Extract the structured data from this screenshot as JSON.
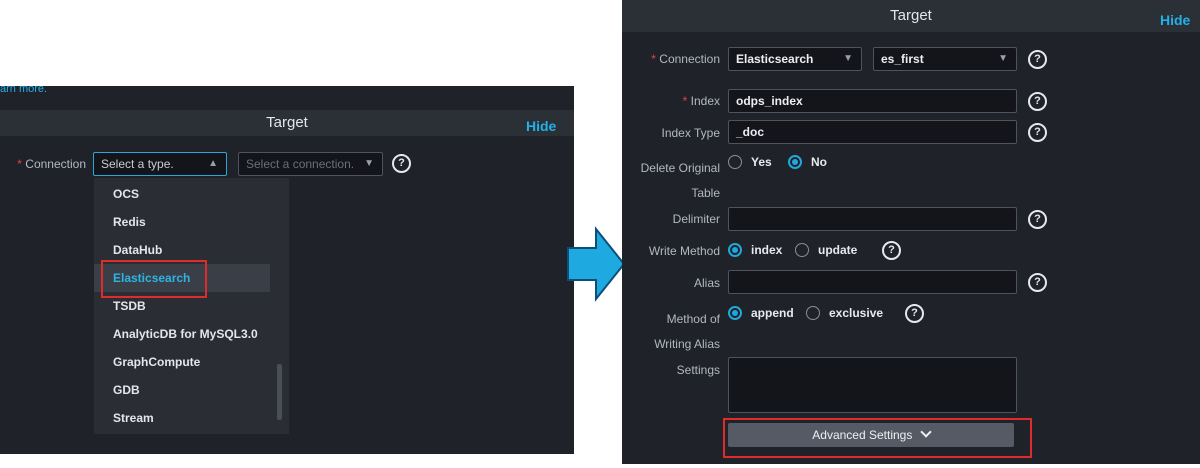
{
  "left": {
    "top_link": "arn more.",
    "header_title": "Target",
    "hide_label": "Hide",
    "connection_label": "Connection",
    "type_select": {
      "placeholder": "Select a type."
    },
    "connection_select": {
      "placeholder": "Select a connection."
    },
    "dropdown_items": [
      "OCS",
      "Redis",
      "DataHub",
      "Elasticsearch",
      "TSDB",
      "AnalyticDB for MySQL3.0",
      "GraphCompute",
      "GDB",
      "Stream"
    ],
    "selected_item": "Elasticsearch"
  },
  "right": {
    "header_title": "Target",
    "hide_label": "Hide",
    "connection": {
      "label": "Connection",
      "type_value": "Elasticsearch",
      "connection_value": "es_first"
    },
    "index": {
      "label": "Index",
      "value": "odps_index"
    },
    "index_type": {
      "label": "Index Type",
      "value": "_doc"
    },
    "delete_original": {
      "label_line1": "Delete Original",
      "label_line2": "Table",
      "yes": "Yes",
      "no": "No",
      "selected": "No"
    },
    "delimiter": {
      "label": "Delimiter",
      "value": ""
    },
    "write_method": {
      "label": "Write Method",
      "index": "index",
      "update": "update",
      "selected": "index"
    },
    "alias": {
      "label": "Alias",
      "value": ""
    },
    "method_alias": {
      "label_line1": "Method of",
      "label_line2": "Writing Alias",
      "append": "append",
      "exclusive": "exclusive",
      "selected": "append"
    },
    "settings": {
      "label": "Settings",
      "value": ""
    },
    "advanced_label": "Advanced Settings"
  },
  "colors": {
    "accent": "#21a8db",
    "highlight": "#e02b2b",
    "panel_bg": "#1f2229",
    "arrow": "#1fa9e1"
  }
}
